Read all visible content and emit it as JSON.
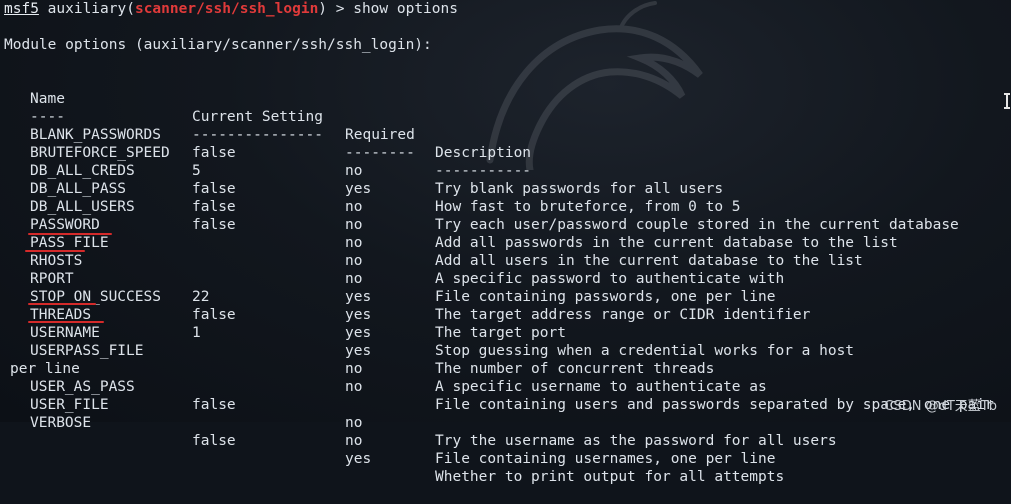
{
  "prompt": {
    "prefix": "msf5",
    "module_keyword": "auxiliary(",
    "module_path": "scanner/ssh/ssh_login",
    "suffix": ") > show options"
  },
  "heading": "Module options (auxiliary/scanner/ssh/ssh_login):",
  "table": {
    "headers": {
      "name": "Name",
      "setting": "Current Setting",
      "required": "Required",
      "description": "Description"
    },
    "separators": {
      "name": "----",
      "setting": "---------------",
      "required": "--------",
      "description": "-----------"
    },
    "rows": [
      {
        "name": "BLANK_PASSWORDS",
        "setting": "false",
        "required": "no",
        "description": "Try blank passwords for all users"
      },
      {
        "name": "BRUTEFORCE_SPEED",
        "setting": "5",
        "required": "yes",
        "description": "How fast to bruteforce, from 0 to 5"
      },
      {
        "name": "DB_ALL_CREDS",
        "setting": "false",
        "required": "no",
        "description": "Try each user/password couple stored in the current database"
      },
      {
        "name": "DB_ALL_PASS",
        "setting": "false",
        "required": "no",
        "description": "Add all passwords in the current database to the list"
      },
      {
        "name": "DB_ALL_USERS",
        "setting": "false",
        "required": "no",
        "description": "Add all users in the current database to the list"
      },
      {
        "name": "PASSWORD",
        "setting": "",
        "required": "no",
        "description": "A specific password to authenticate with"
      },
      {
        "name": "PASS_FILE",
        "setting": "",
        "required": "no",
        "description": "File containing passwords, one per line"
      },
      {
        "name": "RHOSTS",
        "setting": "",
        "required": "yes",
        "description": "The target address range or CIDR identifier"
      },
      {
        "name": "RPORT",
        "setting": "22",
        "required": "yes",
        "description": "The target port"
      },
      {
        "name": "STOP_ON_SUCCESS",
        "setting": "false",
        "required": "yes",
        "description": "Stop guessing when a credential works for a host"
      },
      {
        "name": "THREADS",
        "setting": "1",
        "required": "yes",
        "description": "The number of concurrent threads"
      },
      {
        "name": "USERNAME",
        "setting": "",
        "required": "no",
        "description": "A specific username to authenticate as"
      },
      {
        "name": "USERPASS_FILE",
        "setting": "",
        "required": "no",
        "description": "File containing users and passwords separated by space, one pair"
      },
      {
        "name": "",
        "setting": "",
        "required": "",
        "description": "per line"
      },
      {
        "name": "USER_AS_PASS",
        "setting": "false",
        "required": "no",
        "description": "Try the username as the password for all users"
      },
      {
        "name": "USER_FILE",
        "setting": "",
        "required": "no",
        "description": "File containing usernames, one per line"
      },
      {
        "name": "VERBOSE",
        "setting": "false",
        "required": "yes",
        "description": "Whether to print output for all attempts"
      }
    ]
  },
  "watermark": "CSDN @dT天蓝Tb",
  "colors": {
    "background": "#0f141b",
    "text": "#dde3ea",
    "module_path": "#e03a3a",
    "underline_mark": "#d42a2a"
  },
  "icons": {
    "background_logo": "kali-dragon-icon",
    "cursor": "ibeam-cursor-icon"
  }
}
